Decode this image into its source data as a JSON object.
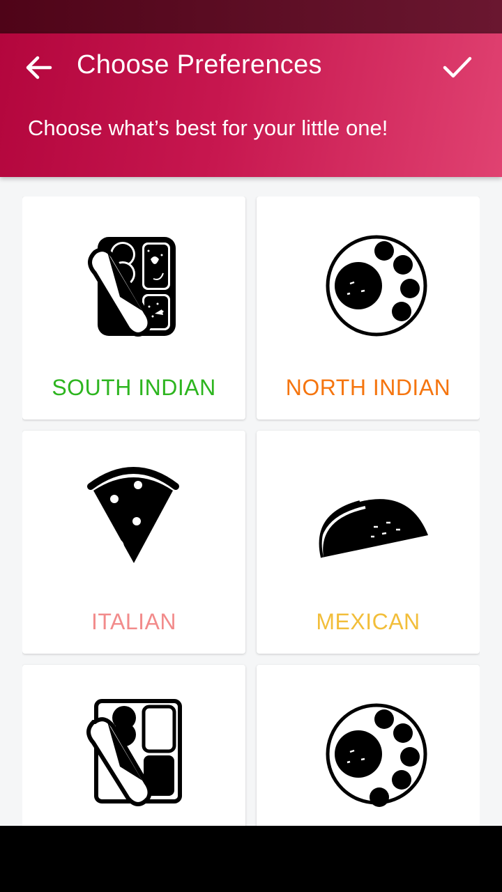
{
  "header": {
    "title": "Choose Preferences",
    "subtitle": "Choose what’s best for your little one!"
  },
  "colors": {
    "header_start": "#b3063d",
    "header_end": "#e04271",
    "status_bar": "#4f0418",
    "background": "#f5f6f7"
  },
  "cuisines": [
    {
      "label": "SOUTH INDIAN",
      "color": "#2db51f",
      "icon": "thali-icon"
    },
    {
      "label": "NORTH INDIAN",
      "color": "#f5750f",
      "icon": "plate-icon"
    },
    {
      "label": "ITALIAN",
      "color": "#f28b8b",
      "icon": "pizza-icon"
    },
    {
      "label": "MEXICAN",
      "color": "#f2be3a",
      "icon": "taco-icon"
    },
    {
      "label": "",
      "color": "#2db51f",
      "icon": "tiffin-icon"
    },
    {
      "label": "",
      "color": "#f5750f",
      "icon": "plate-icon"
    }
  ]
}
